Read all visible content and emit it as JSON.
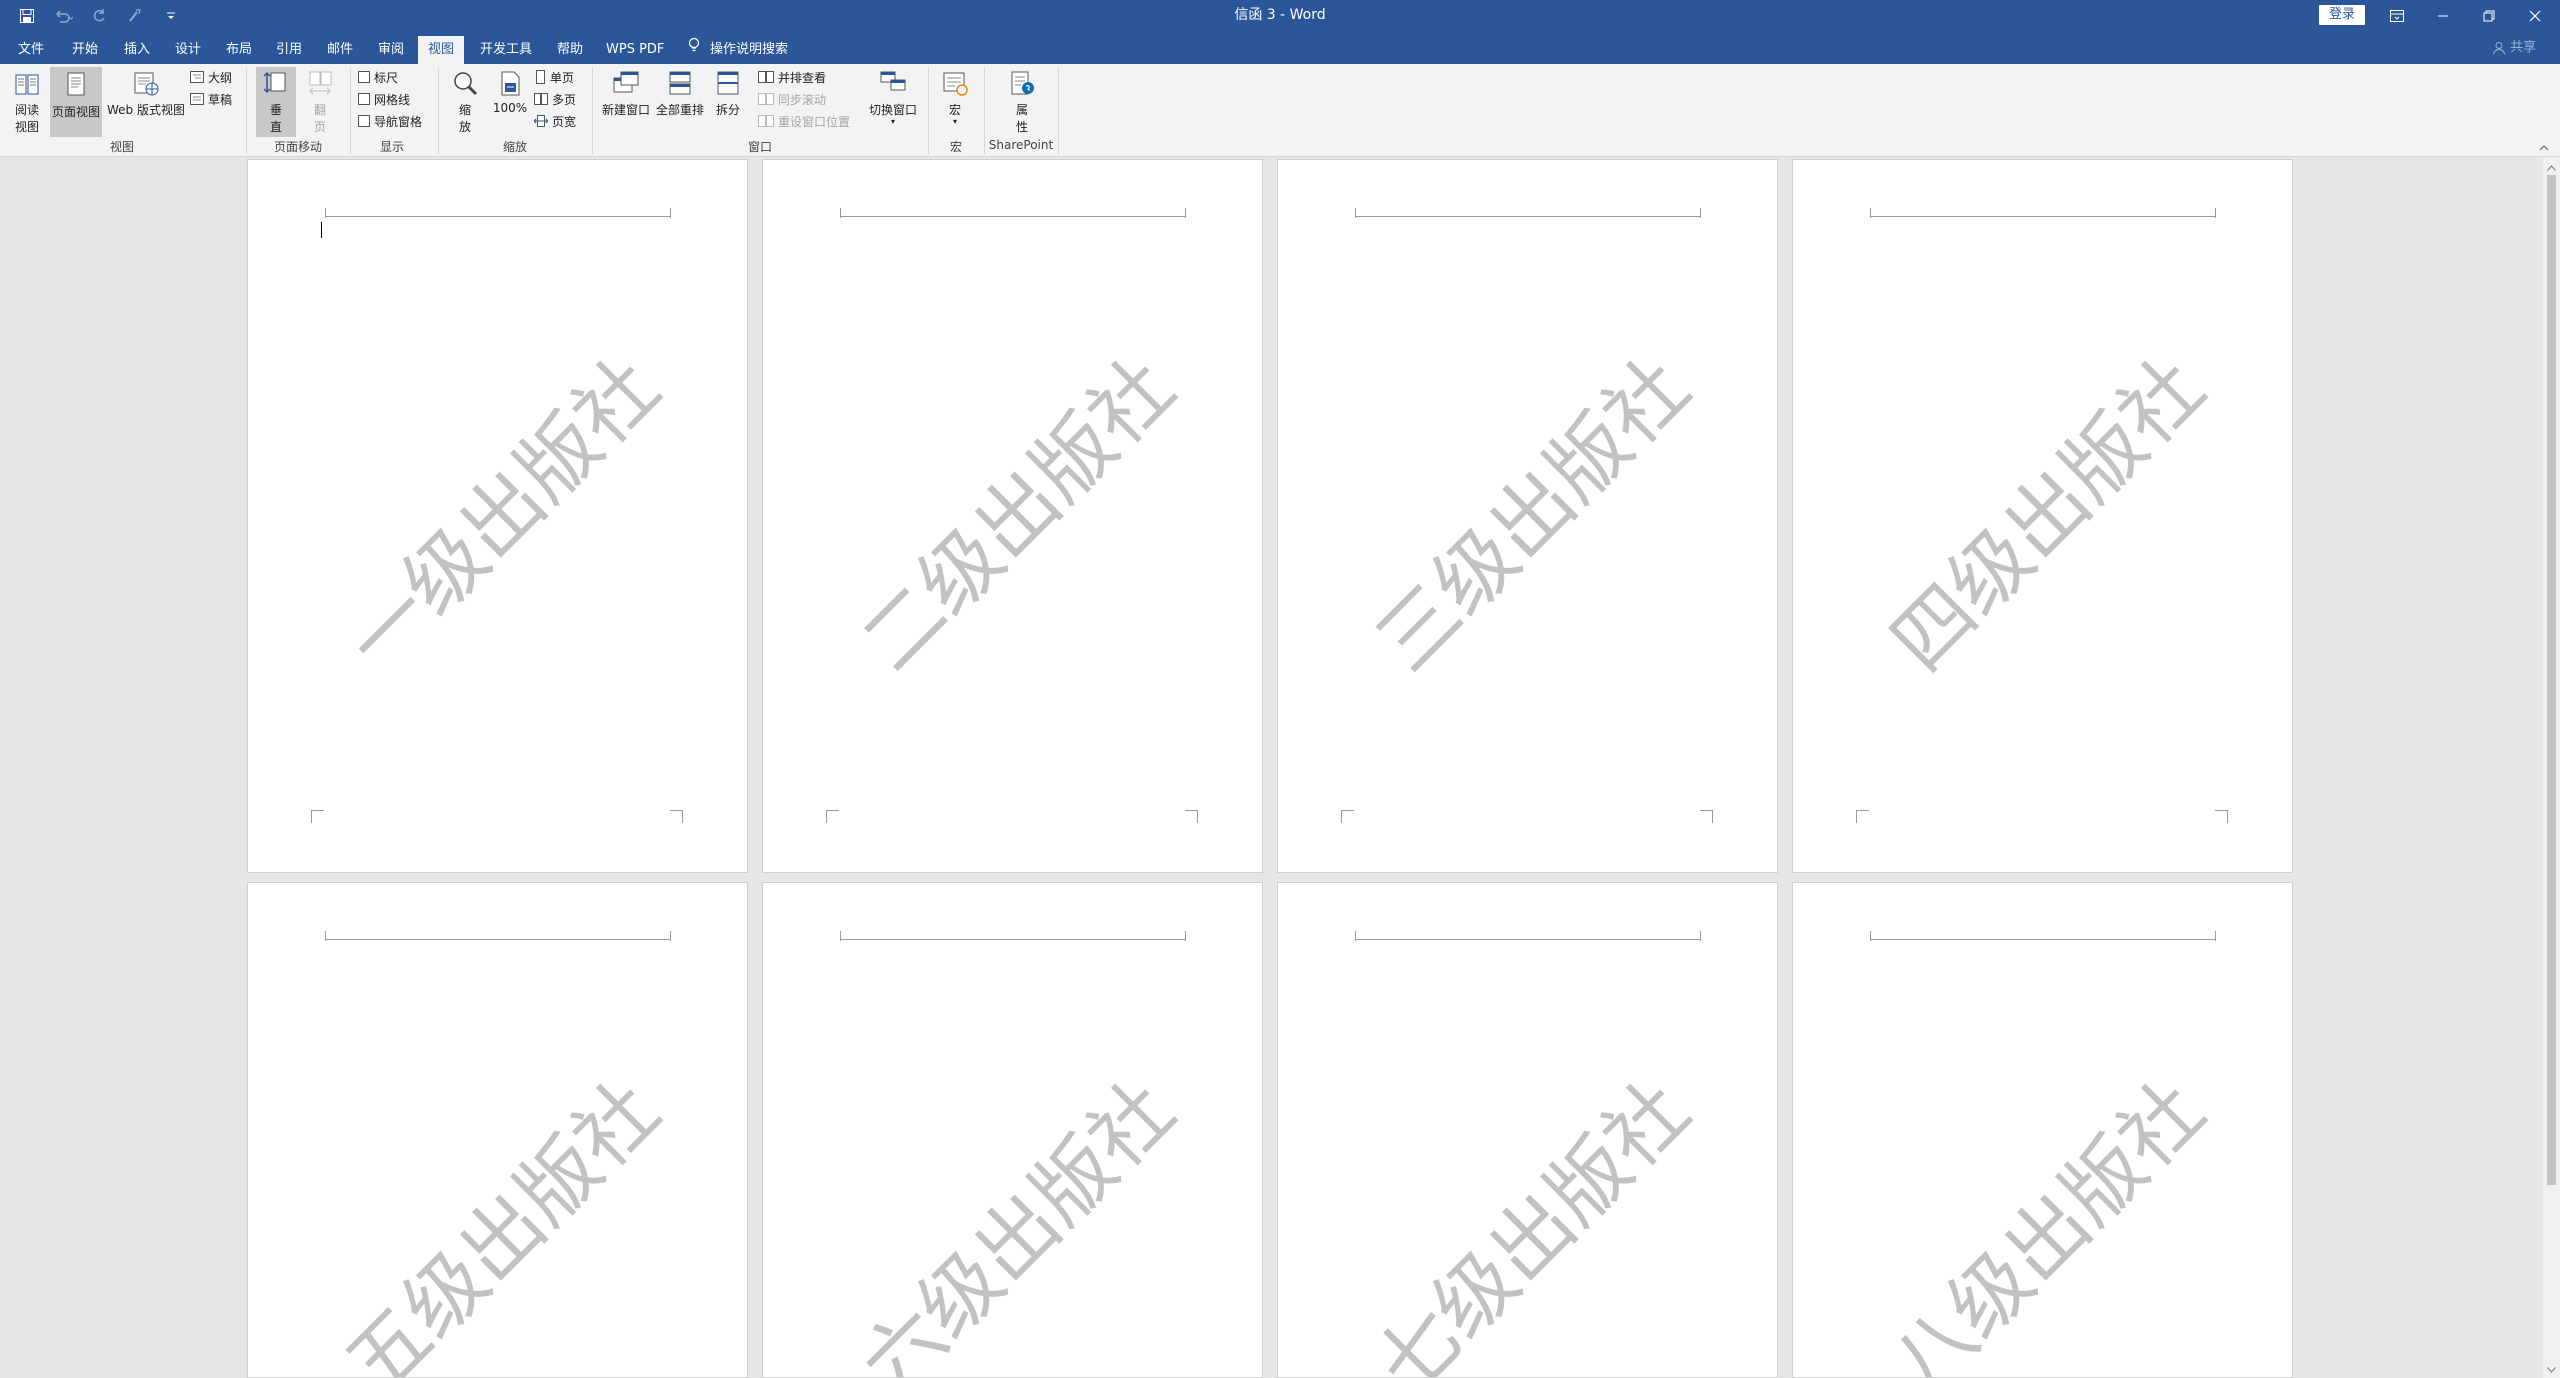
{
  "window": {
    "title": "信函 3 - Word",
    "login_label": "登录",
    "quick_access_icons": [
      "save-icon",
      "undo-icon",
      "redo-icon",
      "repeat-icon",
      "customize-dropdown-icon"
    ]
  },
  "tabs": {
    "file": "文件",
    "home": "开始",
    "insert": "插入",
    "design": "设计",
    "layout": "布局",
    "references": "引用",
    "mailings": "邮件",
    "review": "审阅",
    "view": "视图",
    "developer": "开发工具",
    "help": "帮助",
    "wps_pdf": "WPS PDF",
    "tell_me": "操作说明搜索",
    "share": "共享",
    "active": "视图"
  },
  "ribbon": {
    "views": {
      "read_mode_line1": "阅读",
      "read_mode_line2": "视图",
      "print_layout": "页面视图",
      "web_layout": "Web 版式视图",
      "outline": "大纲",
      "draft": "草稿",
      "group_label": "视图"
    },
    "page_movement": {
      "vertical_line1": "垂",
      "vertical_line2": "直",
      "side_line1": "翻",
      "side_line2": "页",
      "group_label": "页面移动"
    },
    "show": {
      "ruler": "标尺",
      "gridlines": "网格线",
      "nav_pane": "导航窗格",
      "group_label": "显示"
    },
    "zoom": {
      "zoom_line1": "缩",
      "zoom_line2": "放",
      "hundred": "100%",
      "one_page": "单页",
      "multi_page": "多页",
      "page_width": "页宽",
      "group_label": "缩放"
    },
    "window": {
      "new_window": "新建窗口",
      "arrange_all": "全部重排",
      "split": "拆分",
      "side_by_side": "并排查看",
      "sync_scroll": "同步滚动",
      "reset_position": "重设窗口位置",
      "switch_windows": "切换窗口",
      "group_label": "窗口"
    },
    "macros": {
      "macros": "宏",
      "group_label": "宏"
    },
    "sharepoint": {
      "properties_line1": "属",
      "properties_line2": "性",
      "group_label": "SharePoint"
    }
  },
  "pages": [
    {
      "watermark": "一级出版社"
    },
    {
      "watermark": "二级出版社"
    },
    {
      "watermark": "三级出版社"
    },
    {
      "watermark": "四级出版社"
    },
    {
      "watermark": "五级出版社"
    },
    {
      "watermark": "六级出版社"
    },
    {
      "watermark": "七级出版社"
    },
    {
      "watermark": "八级出版社"
    }
  ],
  "colors": {
    "titlebar": "#2b579a",
    "ribbon": "#f3f3f3",
    "workspace": "#e6e6e6",
    "watermark": "#c2c2c2"
  }
}
